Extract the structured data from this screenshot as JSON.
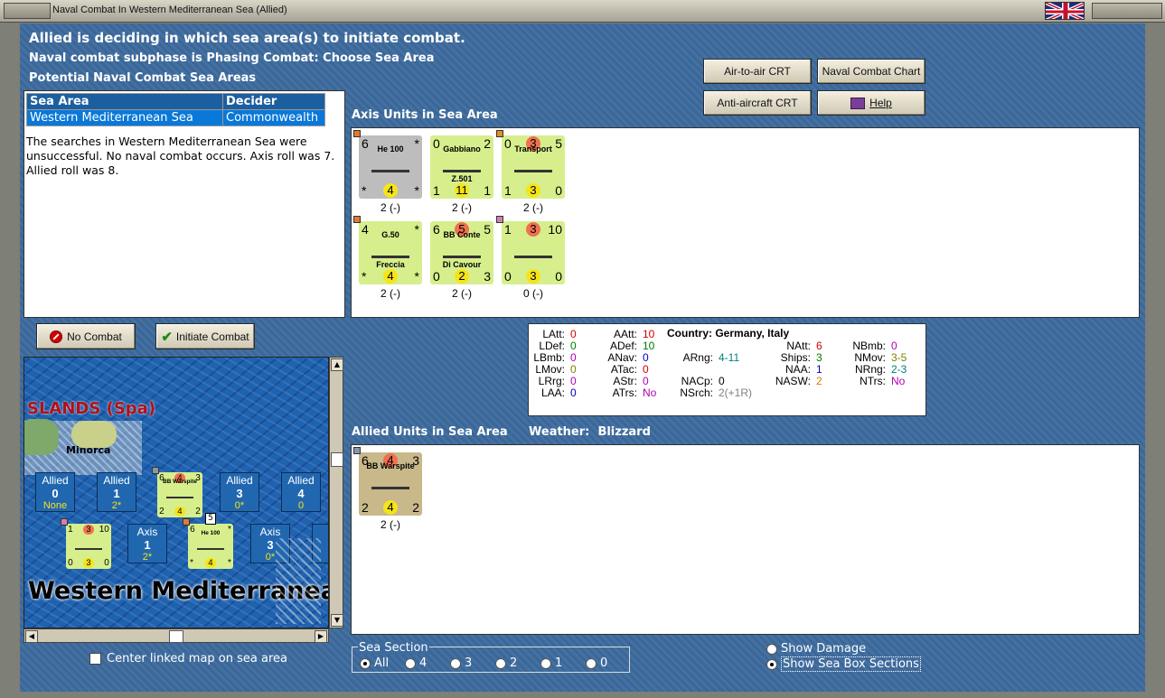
{
  "window": {
    "title": "Naval Combat In Western Mediterranean Sea (Allied)"
  },
  "header": {
    "line1": "Allied is deciding in which sea area(s) to initiate combat.",
    "line2": "Naval combat subphase is Phasing Combat: Choose Sea Area",
    "line3": "Potential Naval Combat Sea Areas"
  },
  "buttons": {
    "air_to_air": "Air-to-air CRT",
    "naval_chart": "Naval Combat Chart",
    "anti_aircraft": "Anti-aircraft CRT",
    "help": "Help",
    "no_combat": "No Combat",
    "initiate": "Initiate Combat"
  },
  "sea_table": {
    "headers": [
      "Sea Area",
      "Decider"
    ],
    "row": {
      "area": "Western Mediterranean Sea",
      "decider": "Commonwealth"
    }
  },
  "search_result": "The searches in Western Mediterranean Sea were unsuccessful.  No naval combat occurs.  Axis roll was 7.  Allied roll was 8.",
  "axis_section": {
    "label": "Axis Units in Sea Area"
  },
  "axis_units": [
    {
      "name": "He 100",
      "tl": "6",
      "tr": "*",
      "bl": "*",
      "bc": "4",
      "br": "*",
      "status": "2 (-)",
      "bg": "#bdbdbd"
    },
    {
      "name": "Gabbiano",
      "tl": "0",
      "tr": "2",
      "sub": "Z.501",
      "bl": "1",
      "bc": "11",
      "br": "1",
      "status": "2 (-)",
      "bg": "#d6ef8c"
    },
    {
      "name": "Transport",
      "tl": "0",
      "tc": "3",
      "tr": "5",
      "bl": "1",
      "bc": "3",
      "br": "0",
      "status": "2 (-)",
      "bg": "#d6ef8c"
    },
    {
      "name": "G.50",
      "sub": "Freccia",
      "tl": "4",
      "tr": "*",
      "bl": "*",
      "bc": "4",
      "br": "*",
      "status": "2 (-)",
      "bg": "#d6ef8c"
    },
    {
      "name": "BB Conte",
      "sub": "Di Cavour",
      "tl": "6",
      "tc": "5",
      "tr": "5",
      "bl": "0",
      "bc": "2",
      "br": "3",
      "status": "2 (-)",
      "bg": "#d6ef8c"
    },
    {
      "name": "",
      "tl": "1",
      "tc": "3",
      "tr": "10",
      "bl": "0",
      "bc": "3",
      "br": "0",
      "status": "0 (-)",
      "bg": "#d6ef8c"
    }
  ],
  "info": {
    "country_label": "Country:",
    "country_value": "Germany, Italy",
    "stats": [
      {
        "k": "LAtt:",
        "v": "0",
        "c": "#d00000"
      },
      {
        "k": "LDef:",
        "v": "0",
        "c": "#007a00"
      },
      {
        "k": "LBmb:",
        "v": "0",
        "c": "#b000b0"
      },
      {
        "k": "LMov:",
        "v": "0",
        "c": "#808000"
      },
      {
        "k": "LRrg:",
        "v": "0",
        "c": "#b000b0"
      },
      {
        "k": "LAA:",
        "v": "0",
        "c": "#0000c0"
      },
      {
        "k": "AAtt:",
        "v": "10",
        "c": "#d00000"
      },
      {
        "k": "ADef:",
        "v": "10",
        "c": "#007a00"
      },
      {
        "k": "ANav:",
        "v": "0",
        "c": "#0000c0"
      },
      {
        "k": "ATac:",
        "v": "0",
        "c": "#d00000"
      },
      {
        "k": "AStr:",
        "v": "0",
        "c": "#b000b0"
      },
      {
        "k": "ATrs:",
        "v": "No",
        "c": "#b000b0"
      },
      {
        "k": "ARng:",
        "v": "4-11",
        "c": "#008080"
      },
      {
        "k": "NACp:",
        "v": "0",
        "c": "#000000"
      },
      {
        "k": "NSrch:",
        "v": "2(+1R)",
        "c": "#808080"
      },
      {
        "k": "NAtt:",
        "v": "6",
        "c": "#d00000"
      },
      {
        "k": "Ships:",
        "v": "3",
        "c": "#007a00"
      },
      {
        "k": "NAA:",
        "v": "1",
        "c": "#0000c0"
      },
      {
        "k": "NASW:",
        "v": "2",
        "c": "#d08000"
      },
      {
        "k": "NBmb:",
        "v": "0",
        "c": "#b000b0"
      },
      {
        "k": "NMov:",
        "v": "3-5",
        "c": "#808000"
      },
      {
        "k": "NRng:",
        "v": "2-3",
        "c": "#008080"
      },
      {
        "k": "NTrs:",
        "v": "No",
        "c": "#b000b0"
      }
    ]
  },
  "allied_section": {
    "label": "Allied Units in Sea Area",
    "weather_label": "Weather:",
    "weather_value": "Blizzard"
  },
  "allied_units": [
    {
      "name": "BB Warspite",
      "tl": "6",
      "tc": "4",
      "tr": "3",
      "bl": "2",
      "bc": "4",
      "br": "2",
      "status": "2 (-)",
      "bg": "#c8b88a"
    }
  ],
  "map": {
    "region_label": "SLANDS (Spa)",
    "island_label": "Minorca",
    "sea_label": "Western Mediterranea",
    "row1": [
      {
        "side": "Allied",
        "num": "0",
        "sub": "None"
      },
      {
        "side": "Allied",
        "num": "1",
        "sub": "2*"
      },
      {
        "side": "Allied",
        "num": "3",
        "sub": "0*"
      },
      {
        "side": "Allied",
        "num": "4",
        "sub": "0"
      }
    ],
    "row2": [
      {
        "side": "Axis",
        "num": "1",
        "sub": "2*"
      },
      {
        "side": "Axis",
        "num": "3",
        "sub": "0*"
      },
      {
        "side": "A"
      }
    ],
    "stack_count": "5",
    "warspite": {
      "name": "BB Warspite",
      "tl": "6",
      "tc": "4",
      "tr": "3",
      "bl": "2",
      "bc": "4",
      "br": "2"
    },
    "transport": {
      "tl": "1",
      "tc": "3",
      "tr": "10",
      "bl": "0",
      "bc": "3",
      "br": "0"
    },
    "he100": {
      "name": "He 100",
      "tl": "6",
      "tr": "*",
      "bl": "*",
      "bc": "4",
      "br": "*"
    }
  },
  "center_map_label": "Center linked map on sea area",
  "sea_section": {
    "title": "Sea Section",
    "options": [
      "All",
      "4",
      "3",
      "2",
      "1",
      "0"
    ],
    "selected": "All"
  },
  "display_options": {
    "show_damage": "Show Damage",
    "show_boxes": "Show Sea Box Sections",
    "selected": "Show Sea Box Sections"
  }
}
